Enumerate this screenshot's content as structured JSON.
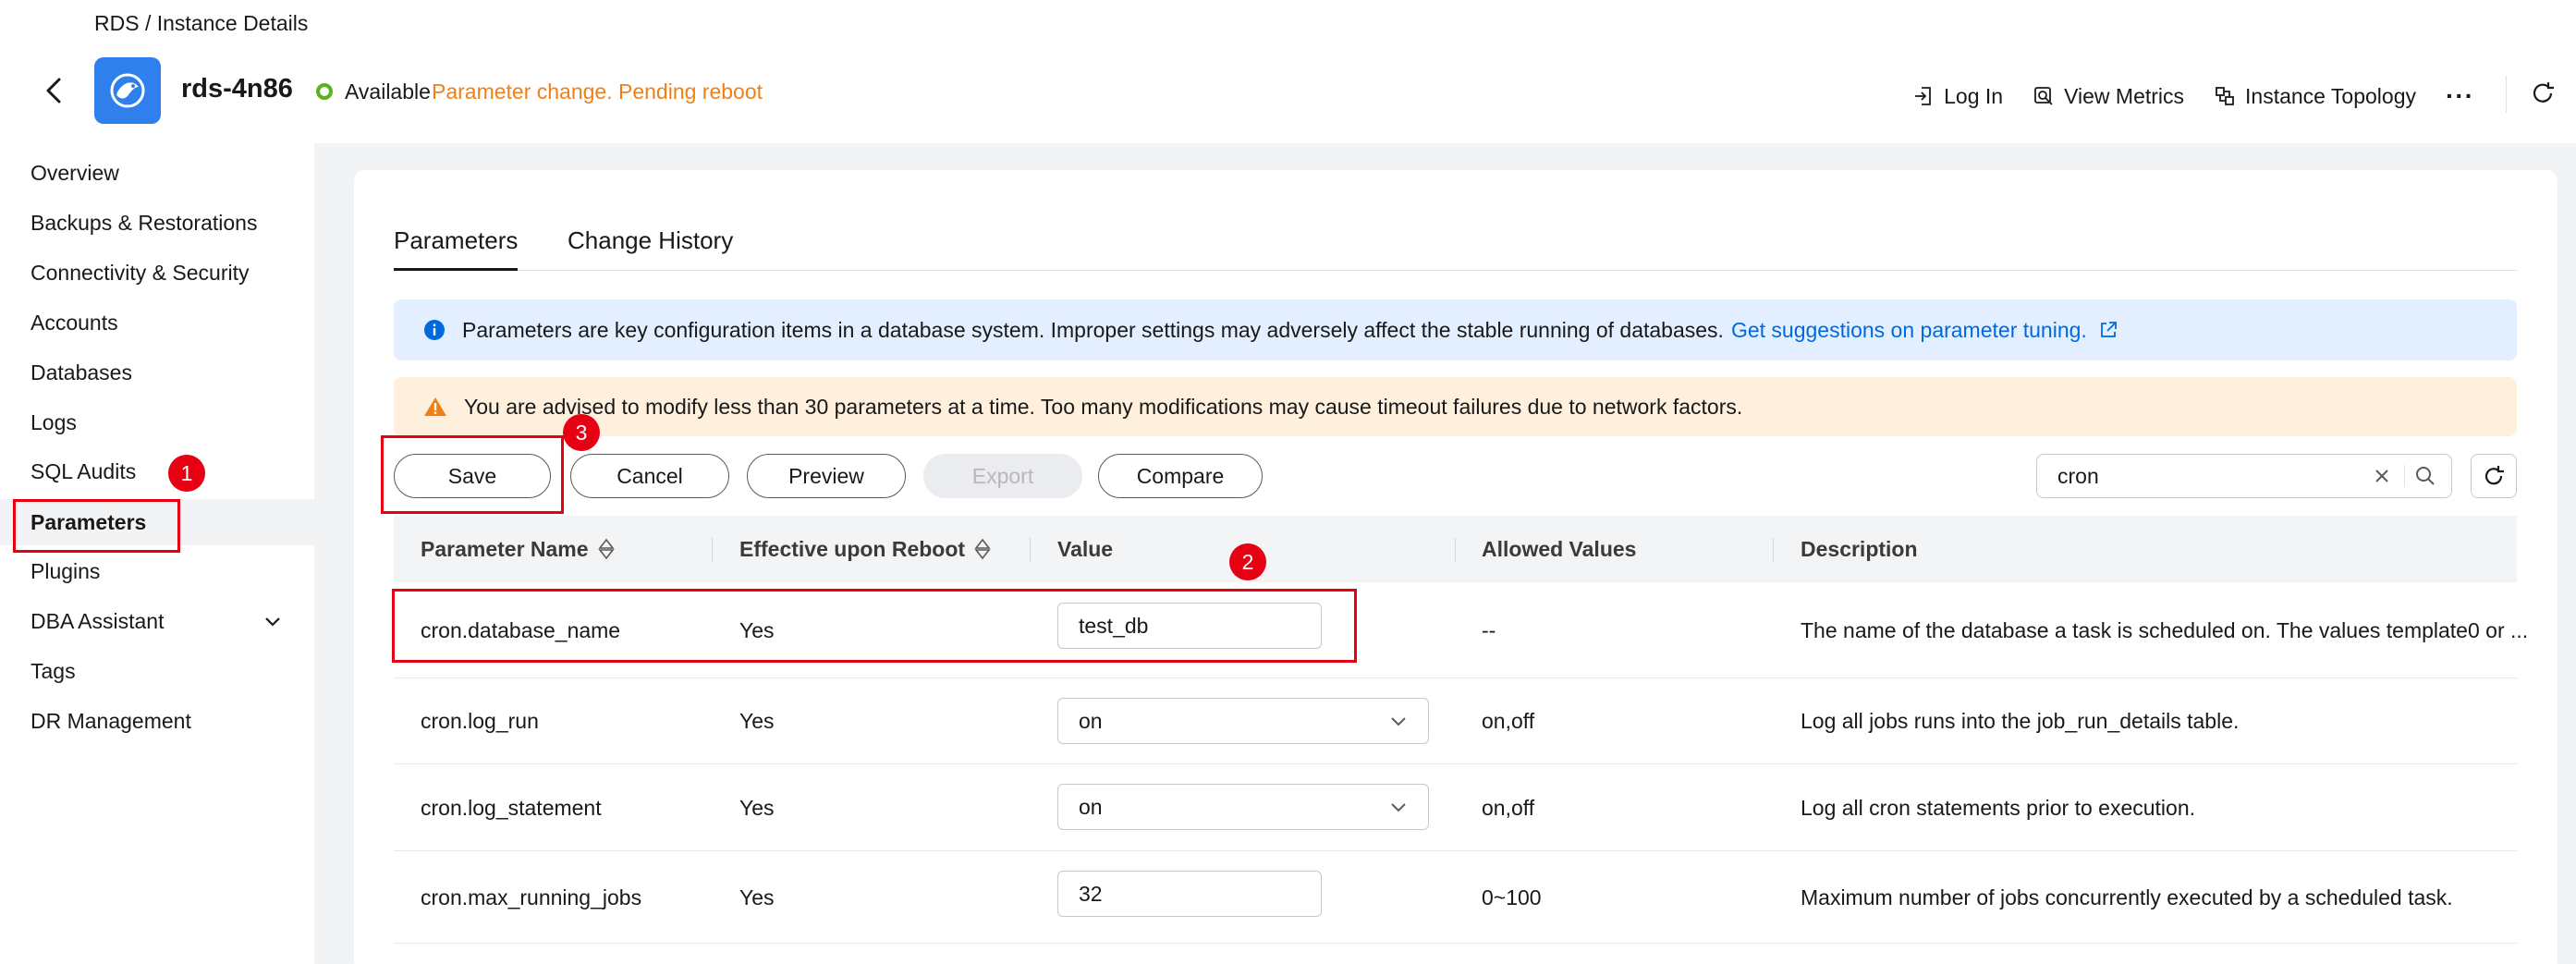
{
  "breadcrumb": "RDS / Instance Details",
  "instance": {
    "name": "rds-4n86",
    "status": "Available",
    "status_warning": "Parameter change. Pending reboot"
  },
  "header_actions": {
    "login": "Log In",
    "metrics": "View Metrics",
    "topology": "Instance Topology",
    "more": "···"
  },
  "sidebar": {
    "items": [
      {
        "label": "Overview"
      },
      {
        "label": "Backups & Restorations"
      },
      {
        "label": "Connectivity & Security"
      },
      {
        "label": "Accounts"
      },
      {
        "label": "Databases"
      },
      {
        "label": "Logs"
      },
      {
        "label": "SQL Audits"
      },
      {
        "label": "Parameters",
        "active": true
      },
      {
        "label": "Plugins"
      },
      {
        "label": "DBA Assistant",
        "expandable": true
      },
      {
        "label": "Tags"
      },
      {
        "label": "DR Management"
      }
    ]
  },
  "tabs": [
    {
      "label": "Parameters",
      "active": true
    },
    {
      "label": "Change History"
    }
  ],
  "alerts": {
    "info": "Parameters are key configuration items in a database system. Improper settings may adversely affect the stable running of databases.",
    "info_link": "Get suggestions on parameter tuning.",
    "warning": "You are advised to modify less than 30 parameters at a time. Too many modifications may cause timeout failures due to network factors."
  },
  "toolbar": {
    "save": "Save",
    "cancel": "Cancel",
    "preview": "Preview",
    "export": "Export",
    "compare": "Compare"
  },
  "search": {
    "value": "cron"
  },
  "table": {
    "headers": {
      "name": "Parameter Name",
      "reboot": "Effective upon Reboot",
      "value": "Value",
      "allowed": "Allowed Values",
      "description": "Description"
    },
    "rows": [
      {
        "name": "cron.database_name",
        "reboot": "Yes",
        "value": "test_db",
        "control": "input",
        "allowed": "--",
        "description": "The name of the database a task is scheduled on. The values template0 or ..."
      },
      {
        "name": "cron.log_run",
        "reboot": "Yes",
        "value": "on",
        "control": "select",
        "allowed": "on,off",
        "description": "Log all jobs runs into the job_run_details table."
      },
      {
        "name": "cron.log_statement",
        "reboot": "Yes",
        "value": "on",
        "control": "select",
        "allowed": "on,off",
        "description": "Log all cron statements prior to execution."
      },
      {
        "name": "cron.max_running_jobs",
        "reboot": "Yes",
        "value": "32",
        "control": "input",
        "allowed": "0~100",
        "description": "Maximum number of jobs concurrently executed by a scheduled task."
      }
    ]
  },
  "annotations": {
    "step1": "1",
    "step2": "2",
    "step3": "3"
  },
  "colors": {
    "accent": "#0069e0",
    "warning_text": "#f07f16",
    "status_ok": "#5bb21a",
    "annotation_red": "#e60012",
    "logo_blue": "#2f80ed"
  }
}
